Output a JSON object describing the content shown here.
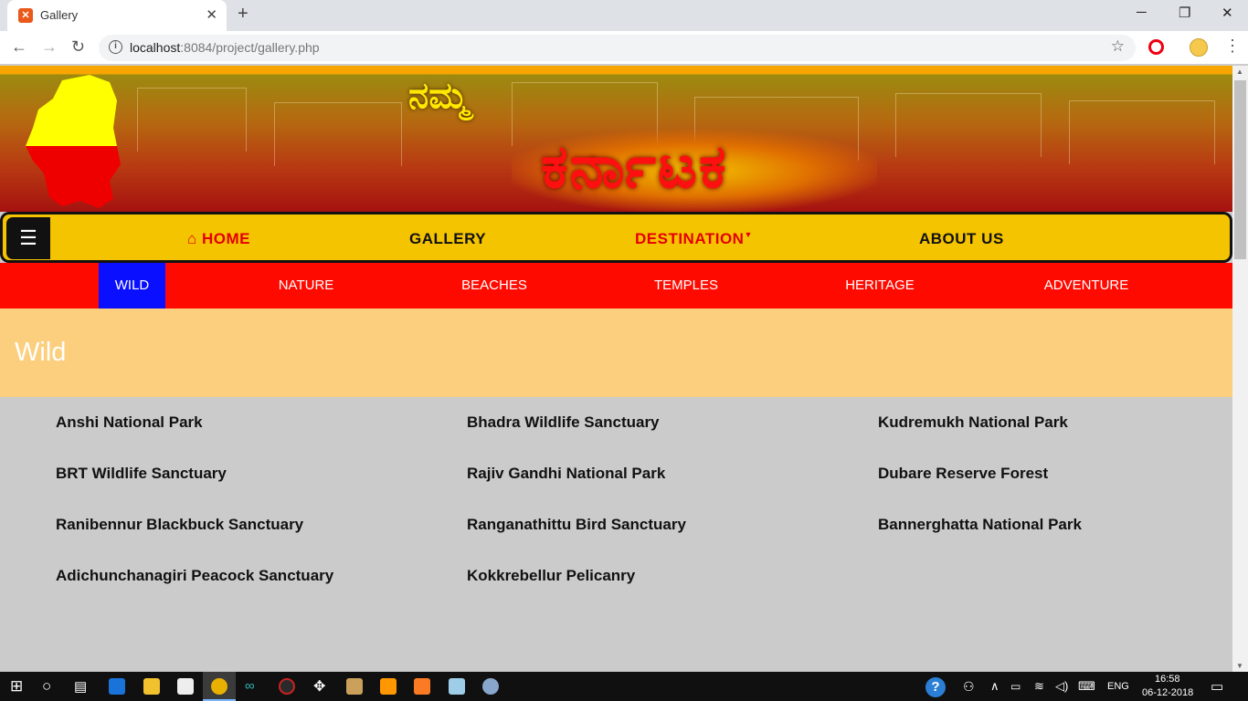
{
  "browser": {
    "tab_title": "Gallery",
    "url_main": "localhost",
    "url_rest": ":8084/project/gallery.php"
  },
  "banner": {
    "logo_small": "ನಮ್ಮ",
    "logo_big": "ಕರ್ನಾಟಕ"
  },
  "nav": {
    "home": "HOME",
    "gallery": "GALLERY",
    "destination": "DESTINATION",
    "about": "ABOUT US"
  },
  "subnav": [
    "WILD",
    "NATURE",
    "BEACHES",
    "TEMPLES",
    "HERITAGE",
    "ADVENTURE"
  ],
  "hero": {
    "title": "Wild"
  },
  "places": [
    [
      "Anshi National Park",
      "Bhadra Wildlife Sanctuary",
      "Kudremukh National Park"
    ],
    [
      "BRT Wildlife Sanctuary",
      "Rajiv Gandhi National Park",
      "Dubare Reserve Forest"
    ],
    [
      "Ranibennur Blackbuck Sanctuary",
      "Ranganathittu Bird Sanctuary",
      "Bannerghatta National Park"
    ],
    [
      "Adichunchanagiri Peacock Sanctuary",
      "Kokkrebellur Pelicanry",
      ""
    ]
  ],
  "taskbar": {
    "lang": "ENG",
    "time": "16:58",
    "date": "06-12-2018"
  },
  "colors": {
    "nav_bg": "#f5c400",
    "subnav_bg": "#ff0a00",
    "active_sub": "#0a10ff",
    "hero_bg": "#fbcf7e",
    "home_red": "#e30000"
  }
}
